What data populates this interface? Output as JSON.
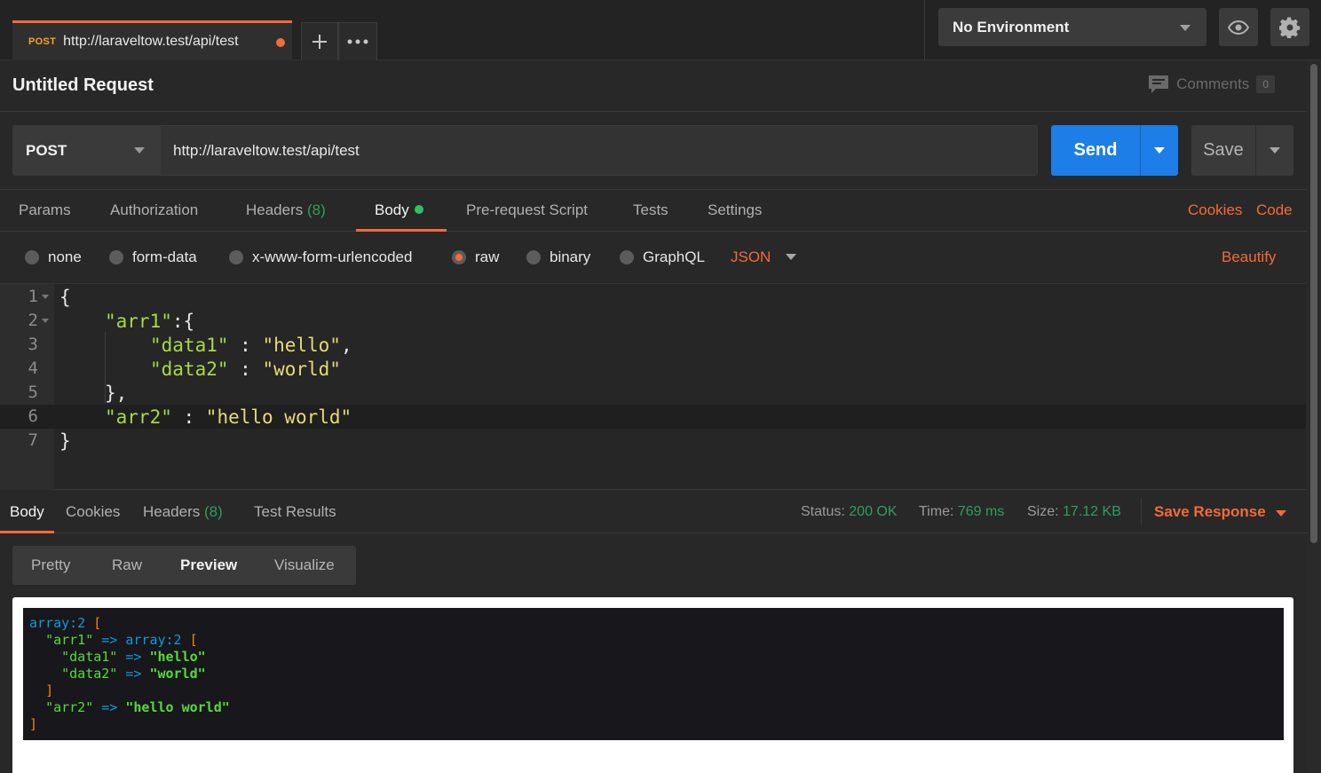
{
  "tab": {
    "method": "POST",
    "url": "http://laraveltow.test/api/test"
  },
  "environment": {
    "selected": "No Environment"
  },
  "request": {
    "title": "Untitled Request",
    "comments_label": "Comments",
    "comments_count": "0",
    "method": "POST",
    "url": "http://laraveltow.test/api/test",
    "send_label": "Send",
    "save_label": "Save"
  },
  "request_tabs": {
    "params": "Params",
    "authorization": "Authorization",
    "headers": "Headers",
    "headers_count": "(8)",
    "body": "Body",
    "pre_request": "Pre-request Script",
    "tests": "Tests",
    "settings": "Settings",
    "cookies": "Cookies",
    "code": "Code"
  },
  "body_types": {
    "none": "none",
    "form_data": "form-data",
    "urlencoded": "x-www-form-urlencoded",
    "raw": "raw",
    "binary": "binary",
    "graphql": "GraphQL",
    "format": "JSON",
    "beautify": "Beautify"
  },
  "editor": {
    "line_numbers": [
      "1",
      "2",
      "3",
      "4",
      "5",
      "6",
      "7"
    ],
    "l1": "{",
    "l2_key": "\"arr1\"",
    "l2_rest": ":{",
    "l3_key": "\"data1\"",
    "l3_sep": " : ",
    "l3_val": "\"hello\"",
    "l3_end": ",",
    "l4_key": "\"data2\"",
    "l4_sep": " : ",
    "l4_val": "\"world\"",
    "l5": "},",
    "l6_key": "\"arr2\"",
    "l6_sep": " : ",
    "l6_val": "\"hello world\"",
    "l7": "}"
  },
  "response_tabs": {
    "body": "Body",
    "cookies": "Cookies",
    "headers": "Headers",
    "headers_count": "(8)",
    "test_results": "Test Results"
  },
  "response_meta": {
    "status_label": "Status:",
    "status_value": "200 OK",
    "time_label": "Time:",
    "time_value": "769 ms",
    "size_label": "Size:",
    "size_value": "17.12 KB",
    "save_response": "Save Response"
  },
  "view_modes": {
    "pretty": "Pretty",
    "raw": "Raw",
    "preview": "Preview",
    "visualize": "Visualize"
  },
  "dump": {
    "type1": "array:2",
    "open": "[",
    "arr1_key": "\"arr1\"",
    "arrow": "=>",
    "type2": "array:2",
    "data1_key": "\"data1\"",
    "data1_val": "\"hello\"",
    "data2_key": "\"data2\"",
    "data2_val": "\"world\"",
    "close": "]",
    "arr2_key": "\"arr2\"",
    "arr2_val": "\"hello world\""
  },
  "colors": {
    "accent": "#f26b3a",
    "send": "#1c7ee6",
    "success": "#2f9e5c"
  }
}
